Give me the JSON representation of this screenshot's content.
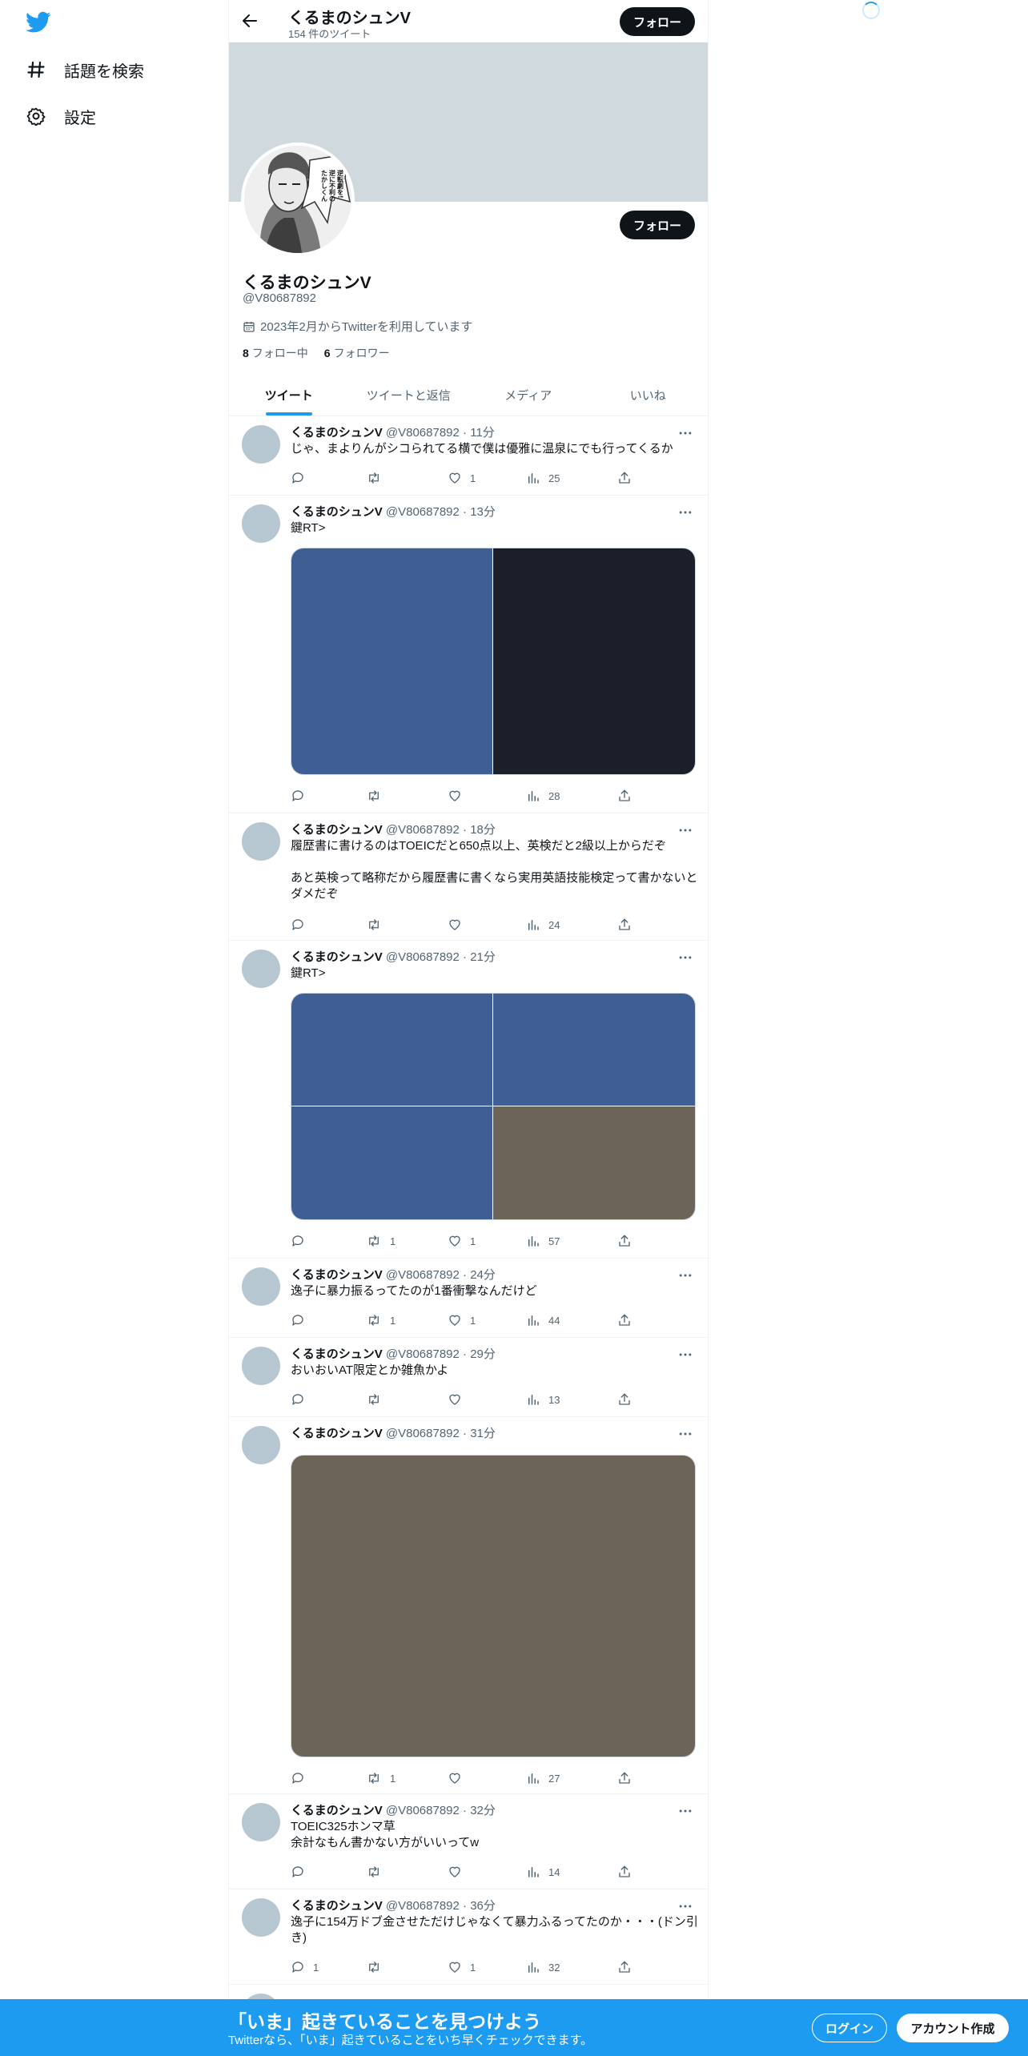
{
  "nav": {
    "items": [
      {
        "label": "話題を検索",
        "icon": "hashtag-icon"
      },
      {
        "label": "設定",
        "icon": "gear-icon"
      }
    ]
  },
  "header": {
    "name": "くるまのシュンV",
    "tweet_count": "154 件のツイート",
    "follow_label": "フォロー"
  },
  "profile": {
    "name": "くるまのシュンV",
    "handle": "@V80687892",
    "joined": "2023年2月からTwitterを利用しています",
    "following_count": "8",
    "following_label": "フォロー中",
    "followers_count": "6",
    "followers_label": "フォロワー",
    "follow_label": "フォロー",
    "avatar_caption": "たかしくんが 逆に不利の大 泣き 逆転 劇を!"
  },
  "tabs": [
    "ツイート",
    "ツイートと返信",
    "メディア",
    "いいね"
  ],
  "tweets": [
    {
      "name": "くるまのシュンV",
      "handle": "@V80687892",
      "time": "11分",
      "text": "じゃ、まよりんがシコられてる横で僕は優雅に温泉にでも行ってくるか",
      "reply": "",
      "retweet": "",
      "like": "1",
      "views": "25"
    },
    {
      "name": "くるまのシュンV",
      "handle": "@V80687892",
      "time": "13分",
      "text": "鍵RT>",
      "reply": "",
      "retweet": "",
      "like": "",
      "views": "28"
    },
    {
      "name": "くるまのシュンV",
      "handle": "@V80687892",
      "time": "18分",
      "text": "履歴書に書けるのはTOEICだと650点以上、英検だと2級以上からだぞ\n\nあと英検って略称だから履歴書に書くなら実用英語技能検定って書かないとダメだぞ",
      "reply": "",
      "retweet": "",
      "like": "",
      "views": "24"
    },
    {
      "name": "くるまのシュンV",
      "handle": "@V80687892",
      "time": "21分",
      "text": "鍵RT>",
      "reply": "",
      "retweet": "1",
      "like": "1",
      "views": "57"
    },
    {
      "name": "くるまのシュンV",
      "handle": "@V80687892",
      "time": "24分",
      "text": "逸子に暴力振るってたのが1番衝撃なんだけど",
      "reply": "",
      "retweet": "1",
      "like": "1",
      "views": "44"
    },
    {
      "name": "くるまのシュンV",
      "handle": "@V80687892",
      "time": "29分",
      "text": "おいおいAT限定とか雑魚かよ",
      "reply": "",
      "retweet": "",
      "like": "",
      "views": "13"
    },
    {
      "name": "くるまのシュンV",
      "handle": "@V80687892",
      "time": "31分",
      "text": "",
      "reply": "",
      "retweet": "1",
      "like": "",
      "views": "27"
    },
    {
      "name": "くるまのシュンV",
      "handle": "@V80687892",
      "time": "32分",
      "text": "TOEIC325ホンマ草\n余計なもん書かない方がいいってw",
      "reply": "",
      "retweet": "",
      "like": "",
      "views": "14"
    },
    {
      "name": "くるまのシュンV",
      "handle": "@V80687892",
      "time": "36分",
      "text": "逸子に154万ドブ金させただけじゃなくて暴力ふるってたのか・・・(ドン引き)",
      "reply": "1",
      "retweet": "",
      "like": "1",
      "views": "32"
    }
  ],
  "bottom": {
    "title": "「いま」起きていることを見つけよう",
    "subtitle": "Twitterなら、「いま」起きていることをいち早くチェックできます。",
    "login": "ログイン",
    "signup": "アカウント作成"
  },
  "colors": {
    "accent": "#1d9bf0",
    "media_blue": "#3f5f94",
    "media_dark": "#1a1f29",
    "media_brown": "#6b6457",
    "avatar_placeholder": "#b6c7d1"
  }
}
